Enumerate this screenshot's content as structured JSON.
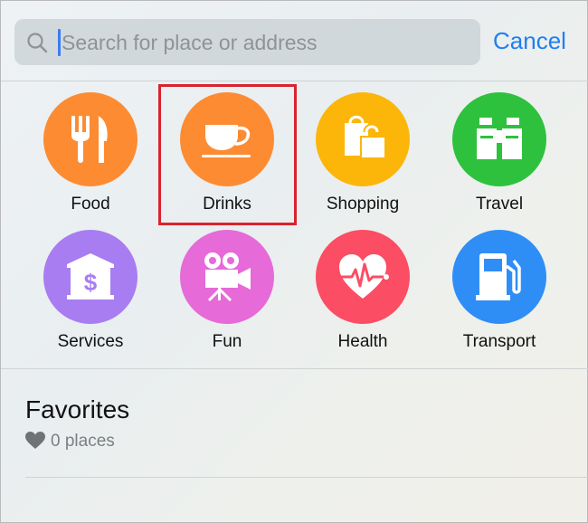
{
  "search": {
    "placeholder": "Search for place or address",
    "cancel_label": "Cancel"
  },
  "categories": [
    {
      "label": "Food",
      "icon": "fork-knife-icon",
      "color": "#fd8b32"
    },
    {
      "label": "Drinks",
      "icon": "coffee-cup-icon",
      "color": "#fd8b32",
      "highlighted": true
    },
    {
      "label": "Shopping",
      "icon": "shopping-bags-icon",
      "color": "#fcb60a"
    },
    {
      "label": "Travel",
      "icon": "binoculars-icon",
      "color": "#2ec13d"
    },
    {
      "label": "Services",
      "icon": "bank-dollar-icon",
      "color": "#a77df1"
    },
    {
      "label": "Fun",
      "icon": "movie-camera-icon",
      "color": "#e66ad7"
    },
    {
      "label": "Health",
      "icon": "heart-pulse-icon",
      "color": "#fb4d63"
    },
    {
      "label": "Transport",
      "icon": "gas-pump-icon",
      "color": "#2f8ef5"
    }
  ],
  "highlight_color": "#d9232f",
  "favorites": {
    "title": "Favorites",
    "count_text": "0 places",
    "icon": "heart-icon"
  }
}
